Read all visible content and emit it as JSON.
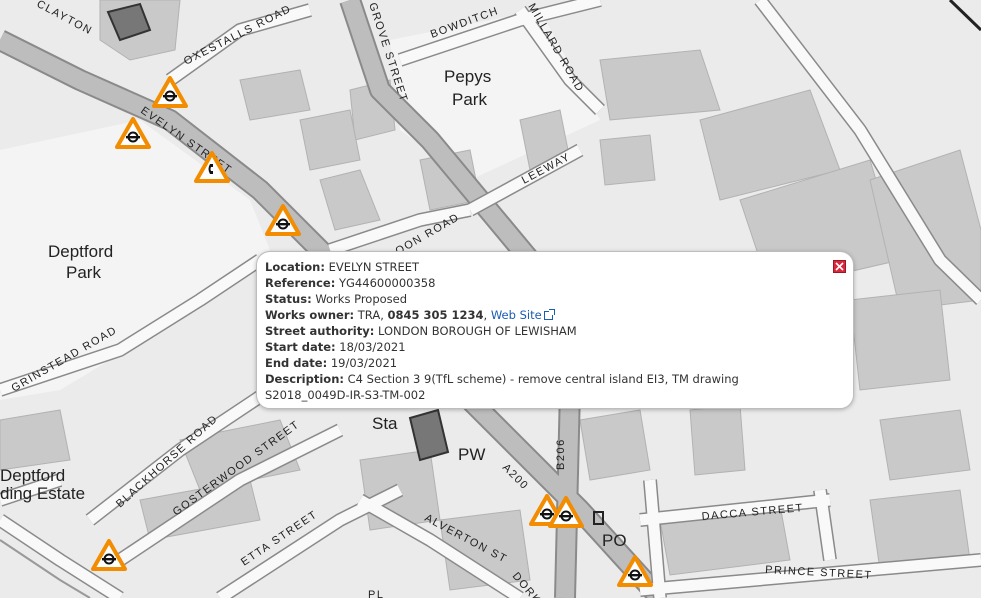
{
  "map": {
    "labels": {
      "pepys_park": [
        "Pepys",
        "Park"
      ],
      "deptford_park": [
        "Deptford",
        "Park"
      ],
      "deptford_estate": [
        "Deptford",
        "ding Estate"
      ],
      "evelyn_street": "EVELYN STREET",
      "grove_street": "GROVE STREET",
      "oxestalls_road": "OXESTALLS ROAD",
      "clayton": "CLAYTON",
      "bowditch": "BOWDITCH",
      "millard_road": "MILLARD ROAD",
      "leeway": "LEEWAY",
      "oon_road": "OON ROAD",
      "grinstead_road": "GRINSTEAD ROAD",
      "blackhorse_road": "BLACKHORSE ROAD",
      "gosterwood_street": "GOSTERWOOD STREET",
      "etta_street": "ETTA STREET",
      "alverton_st": "ALVERTON ST",
      "dorking": "DORK",
      "dacca_street": "DACCA STREET",
      "prince_street": "PRINCE STREET",
      "a200": "A200",
      "b206": "B206",
      "sta": "Sta",
      "pw": "PW",
      "po": "PO",
      "pl": "PL"
    },
    "markers": [
      {
        "name": "roadworks-marker-1",
        "icon": "tfl-roundel-icon"
      },
      {
        "name": "roadworks-marker-2",
        "icon": "tfl-roundel-icon"
      },
      {
        "name": "roadworks-marker-3",
        "icon": "phone-icon"
      },
      {
        "name": "roadworks-marker-4",
        "icon": "tfl-roundel-icon"
      },
      {
        "name": "roadworks-marker-5",
        "icon": "tfl-roundel-icon"
      },
      {
        "name": "roadworks-marker-6",
        "icon": "tfl-roundel-icon"
      },
      {
        "name": "roadworks-marker-7",
        "icon": "tfl-roundel-icon"
      },
      {
        "name": "roadworks-marker-8",
        "icon": "tfl-roundel-icon"
      }
    ],
    "marker_color": "#f28c00"
  },
  "popup": {
    "location_label": "Location:",
    "location_value": "EVELYN STREET",
    "reference_label": "Reference:",
    "reference_value": "YG44600000358",
    "status_label": "Status:",
    "status_value": "Works Proposed",
    "owner_label": "Works owner:",
    "owner_name": "TRA",
    "owner_phone": "0845 305 1234",
    "owner_link": "Web Site",
    "authority_label": "Street authority:",
    "authority_value": "LONDON BOROUGH OF LEWISHAM",
    "start_label": "Start date:",
    "start_value": "18/03/2021",
    "end_label": "End date:",
    "end_value": "19/03/2021",
    "description_label": "Description:",
    "description_value": "C4 Section 3 9(TfL scheme) - remove central island EI3, TM drawing S2018_0049D-IR-S3-TM-002",
    "close_icon": "close-icon",
    "link_color": "#1a5bb5",
    "close_color": "#d8283c"
  }
}
